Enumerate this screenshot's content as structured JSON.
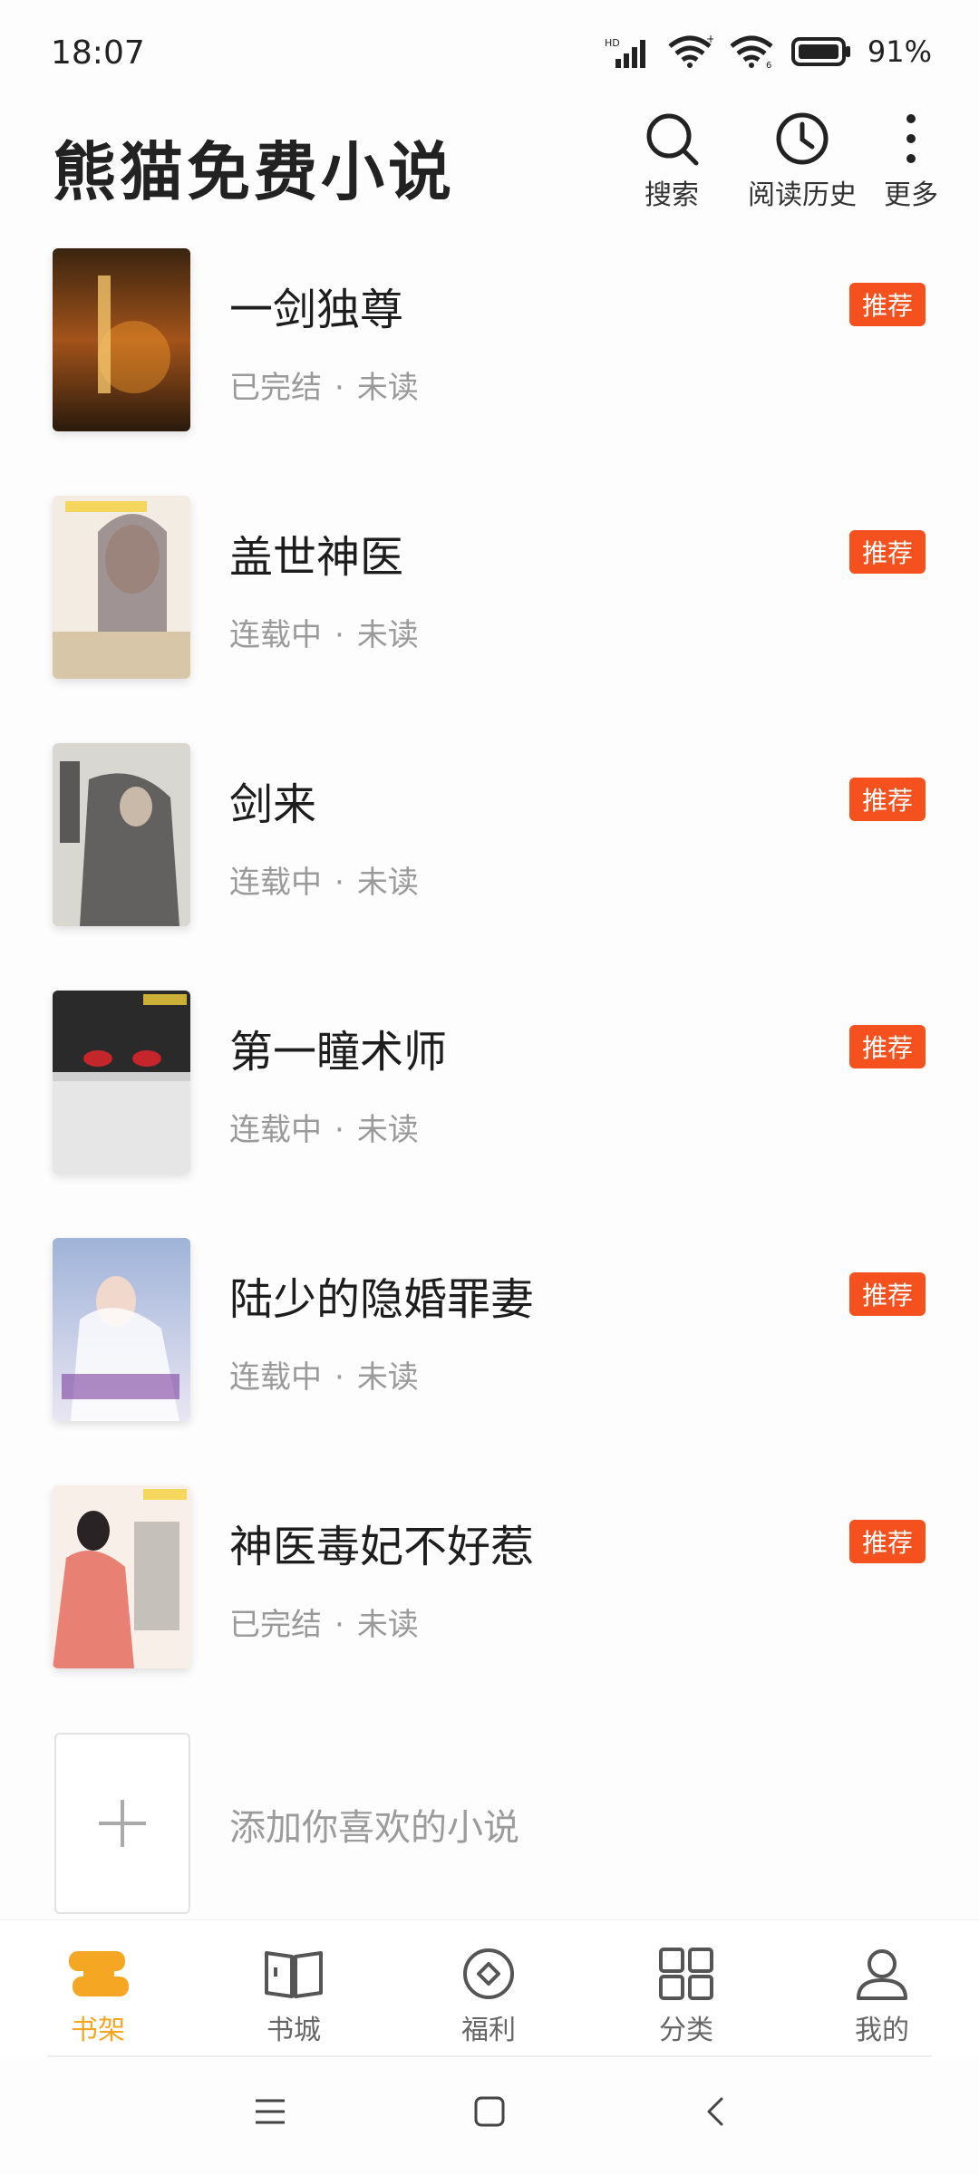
{
  "status_bar": {
    "time": "18:07",
    "battery": "91%"
  },
  "header": {
    "title": "熊猫免费小说",
    "actions": [
      {
        "icon": "search-icon",
        "label": "搜索"
      },
      {
        "icon": "clock-icon",
        "label": "阅读历史"
      },
      {
        "icon": "more-vertical-icon",
        "label": "更多"
      }
    ]
  },
  "books": [
    {
      "title": "一剑独尊",
      "status": "已完结",
      "progress": "未读",
      "badge": "推荐"
    },
    {
      "title": "盖世神医",
      "status": "连载中",
      "progress": "未读",
      "badge": "推荐"
    },
    {
      "title": "剑来",
      "status": "连载中",
      "progress": "未读",
      "badge": "推荐"
    },
    {
      "title": "第一瞳术师",
      "status": "连载中",
      "progress": "未读",
      "badge": "推荐"
    },
    {
      "title": "陆少的隐婚罪妻",
      "status": "连载中",
      "progress": "未读",
      "badge": "推荐"
    },
    {
      "title": "神医毒妃不好惹",
      "status": "已完结",
      "progress": "未读",
      "badge": "推荐"
    }
  ],
  "meta_separator": "·",
  "add_book": {
    "label": "添加你喜欢的小说"
  },
  "bottom_nav": [
    {
      "icon": "bookshelf-icon",
      "label": "书架",
      "active": true
    },
    {
      "icon": "open-book-icon",
      "label": "书城",
      "active": false
    },
    {
      "icon": "coin-icon",
      "label": "福利",
      "active": false
    },
    {
      "icon": "grid-icon",
      "label": "分类",
      "active": false
    },
    {
      "icon": "person-icon",
      "label": "我的",
      "active": false
    }
  ],
  "colors": {
    "accent": "#f5a623",
    "badge": "#f4511e",
    "muted_text": "#9a9a9a"
  }
}
